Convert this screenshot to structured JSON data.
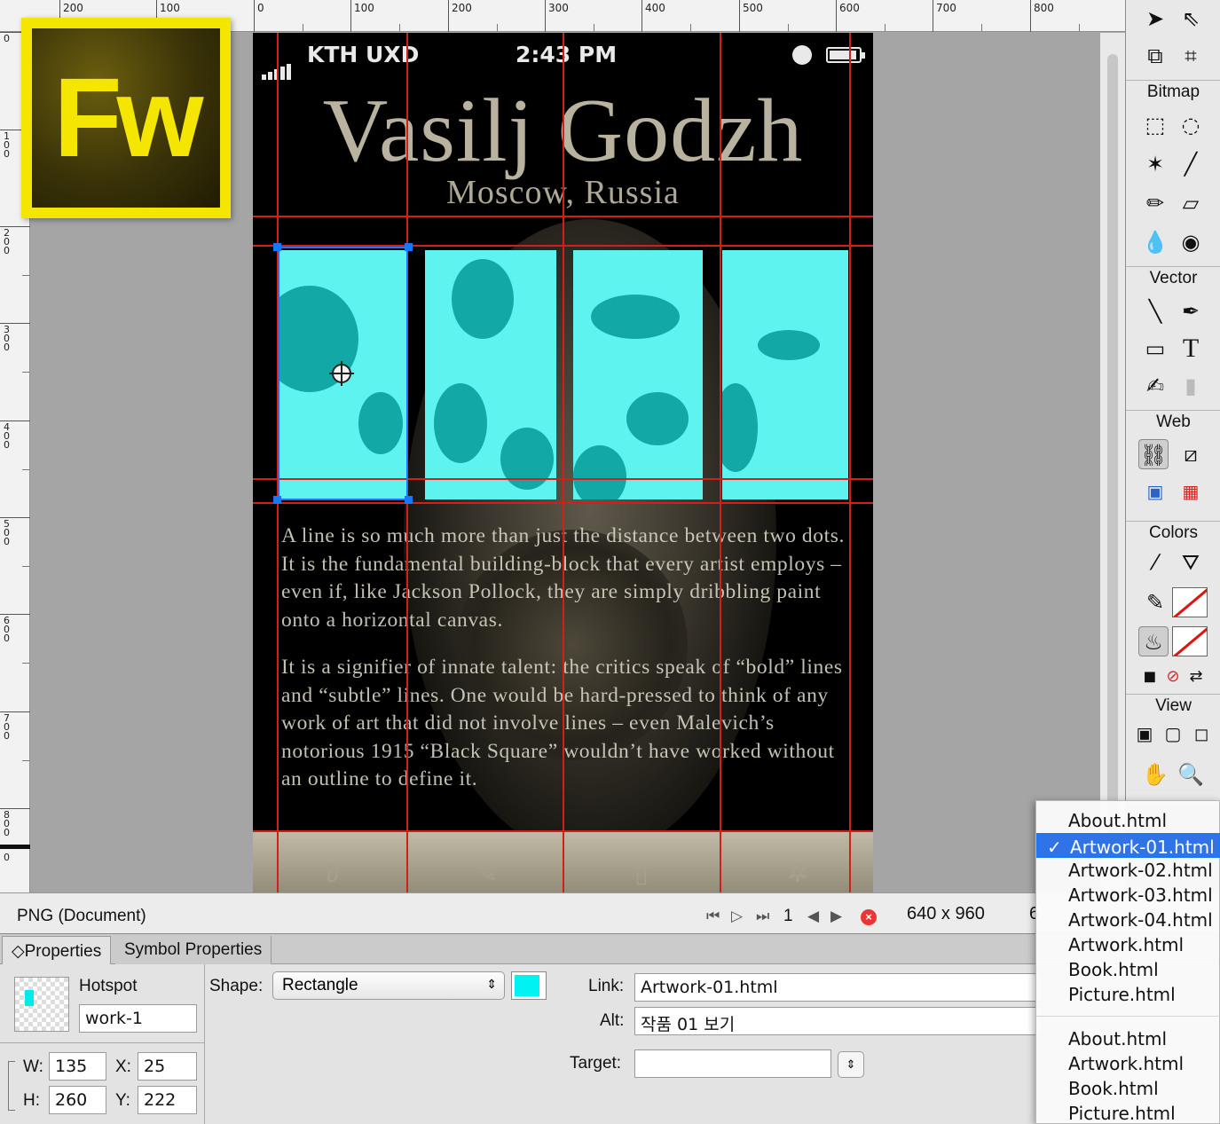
{
  "logo": {
    "text": "Fw"
  },
  "rulers": {
    "horizontal": [
      "200",
      "100",
      "0",
      "100",
      "200",
      "300",
      "400",
      "500",
      "600",
      "700",
      "800"
    ],
    "vertical": [
      "0",
      "100",
      "200",
      "300",
      "400",
      "500",
      "600",
      "700",
      "800",
      "0"
    ]
  },
  "phone": {
    "carrier": "KTH UXD",
    "time": "2:43 PM",
    "title": "Vasilj Godzh",
    "subtitle": "Moscow, Russia",
    "paragraph1": "A line is so much more than just the distance between two dots. It is the fundamental building-block that every artist employs – even if, like Jackson Pollock, they are simply dribbling paint onto a horizontal canvas.",
    "paragraph2": "It is a signifier of innate talent: the critics speak of “bold” lines and “subtle” lines. One would be hard-pressed to think of any work of art that did not involve lines – even Malevich’s notorious 1915 “Black Square” wouldn’t have worked without an outline to define it.",
    "tab_icons": [
      "person-icon",
      "brush-icon",
      "book-icon",
      "aperture-icon"
    ]
  },
  "tools": {
    "sections": [
      "Bitmap",
      "Vector",
      "Web",
      "Colors",
      "View"
    ],
    "text_tool": "T"
  },
  "statusbar": {
    "document": "PNG (Document)",
    "frame": "1",
    "dimensions": "640 x 960",
    "dimensions_overflow": "6"
  },
  "properties": {
    "tabs": [
      "Properties",
      "Symbol Properties"
    ],
    "object_type": "Hotspot",
    "name": "work-1",
    "w_label": "W:",
    "w": "135",
    "h_label": "H:",
    "h": "260",
    "x_label": "X:",
    "x": "25",
    "y_label": "Y:",
    "y": "222",
    "shape_label": "Shape:",
    "shape": "Rectangle",
    "link_label": "Link:",
    "link": "Artwork-01.html",
    "alt_label": "Alt:",
    "alt": "작품 01 보기",
    "target_label": "Target:",
    "target": "",
    "hotspot_color": "#00f2f2"
  },
  "link_menu": {
    "items": [
      "About.html",
      "Artwork-01.html",
      "Artwork-02.html",
      "Artwork-03.html",
      "Artwork-04.html",
      "Artwork.html",
      "Book.html",
      "Picture.html"
    ],
    "items2": [
      "About.html",
      "Artwork.html",
      "Book.html",
      "Picture.html"
    ],
    "selected": "Artwork-01.html",
    "check": "✓"
  },
  "colors": {
    "guide": "#d21f1a",
    "selection": "#1877ff",
    "thumbnail": "#5ff3f0",
    "menu_highlight": "#2f73e6"
  }
}
